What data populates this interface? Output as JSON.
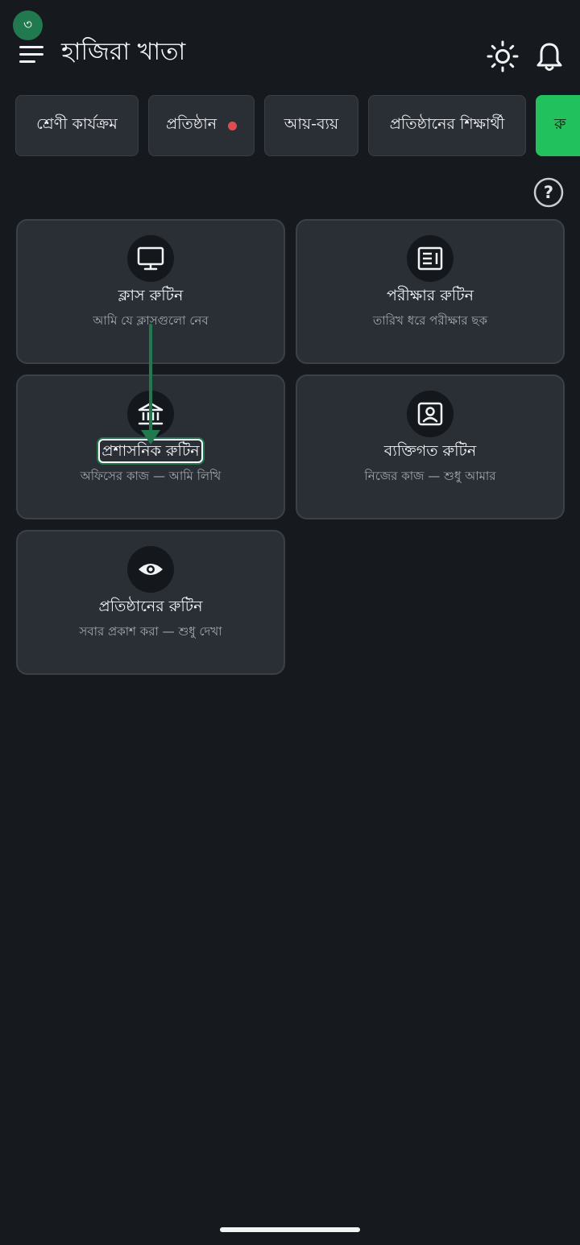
{
  "step_badge": "৩",
  "header": {
    "title": "হাজিরা খাতা"
  },
  "tabs": [
    {
      "label": "শ্রেণী কার্যক্রম",
      "has_dot": false,
      "active": false
    },
    {
      "label": "প্রতিষ্ঠান",
      "has_dot": true,
      "active": false
    },
    {
      "label": "আয়-ব্যয়",
      "has_dot": false,
      "active": false
    },
    {
      "label": "প্রতিষ্ঠানের শিক্ষার্থী",
      "has_dot": false,
      "active": false
    },
    {
      "label": "রু",
      "has_dot": false,
      "active": true
    }
  ],
  "cards": [
    {
      "icon": "monitor-icon",
      "title": "ক্লাস রুটিন",
      "subtitle": "আমি যে ক্লাসগুলো নেব"
    },
    {
      "icon": "newspaper-icon",
      "title": "পরীক্ষার রুটিন",
      "subtitle": "তারিখ ধরে পরীক্ষার ছক"
    },
    {
      "icon": "institution-icon",
      "title": "প্রশাসনিক রুটিন",
      "subtitle": "অফিসের কাজ — আমি লিখি",
      "highlighted": true
    },
    {
      "icon": "person-card-icon",
      "title": "ব্যক্তিগত রুটিন",
      "subtitle": "নিজের কাজ — শুধু আমার"
    },
    {
      "icon": "eye-icon",
      "title": "প্রতিষ্ঠানের রুটিন",
      "subtitle": "সবার প্রকাশ করা — শুধু দেখা"
    }
  ],
  "colors": {
    "background": "#161a1f",
    "card": "#2a2f36",
    "accent_green": "#21c25d",
    "badge_green": "#1f7a4f",
    "notification_dot": "#e5484d"
  }
}
